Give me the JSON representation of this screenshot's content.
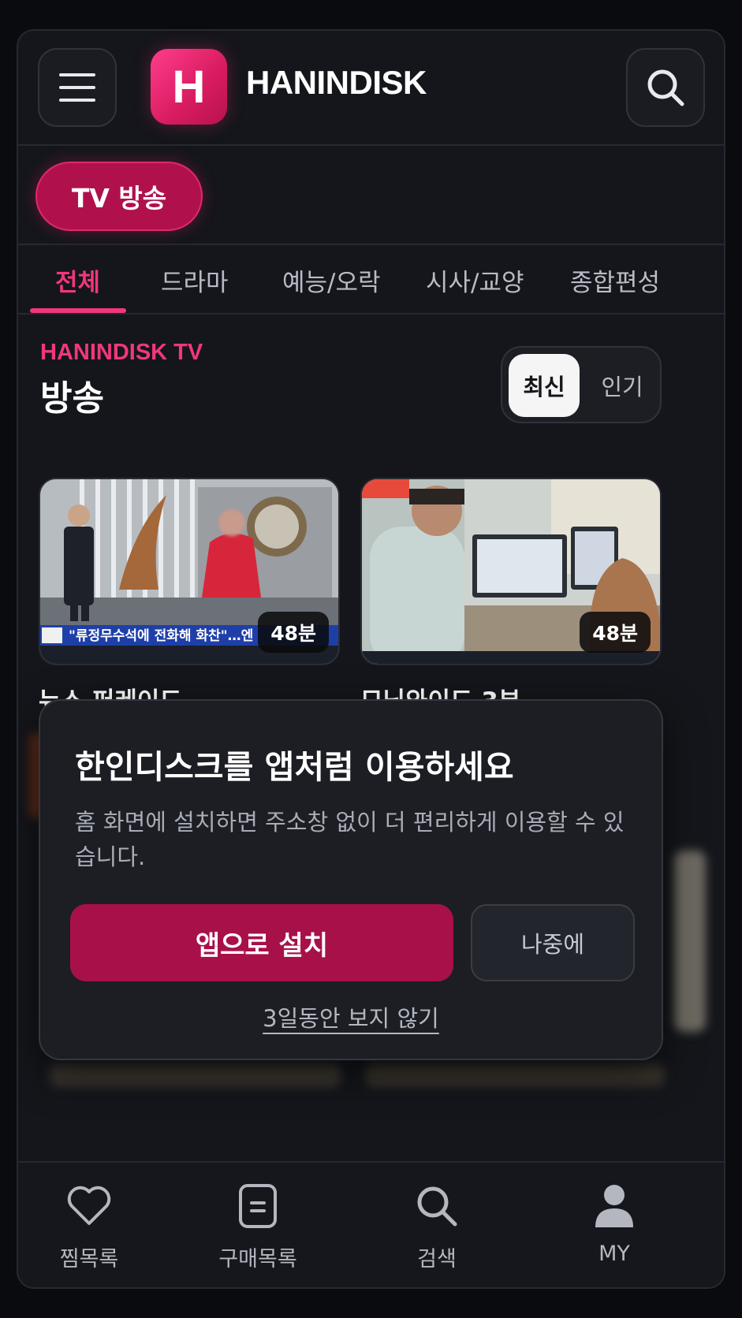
{
  "header": {
    "logo_letter": "H",
    "brand": "HANINDISK"
  },
  "category": {
    "label": "TV 방송"
  },
  "tabs": [
    {
      "label": "전체",
      "active": true
    },
    {
      "label": "드라마"
    },
    {
      "label": "예능/오락"
    },
    {
      "label": "시사/교양"
    },
    {
      "label": "종합편성"
    }
  ],
  "section": {
    "eyebrow": "HANINDISK TV",
    "title": "방송",
    "sort_latest": "최신",
    "sort_popular": "인기"
  },
  "cards": [
    {
      "title": "뉴스 퍼레이드",
      "duration": "48분",
      "caption": "\"류정무수석에 전화해 화찬\"…엔"
    },
    {
      "title": "모닝와이드 3부",
      "duration": "48분"
    }
  ],
  "modal": {
    "title": "한인디스크를 앱처럼 이용하세요",
    "description": "홈 화면에 설치하면 주소창 없이 더 편리하게 이용할 수 있습니다.",
    "install_label": "앱으로 설치",
    "later_label": "나중에",
    "hide_label": "3일동안 보지 않기"
  },
  "bottom_nav": [
    {
      "label": "찜목록",
      "icon": "heart-icon"
    },
    {
      "label": "구매목록",
      "icon": "receipt-icon"
    },
    {
      "label": "검색",
      "icon": "search-icon"
    },
    {
      "label": "MY",
      "icon": "user-icon"
    }
  ],
  "colors": {
    "accent": "#f0377e",
    "install_button": "#a8104a",
    "background": "#14161b"
  }
}
